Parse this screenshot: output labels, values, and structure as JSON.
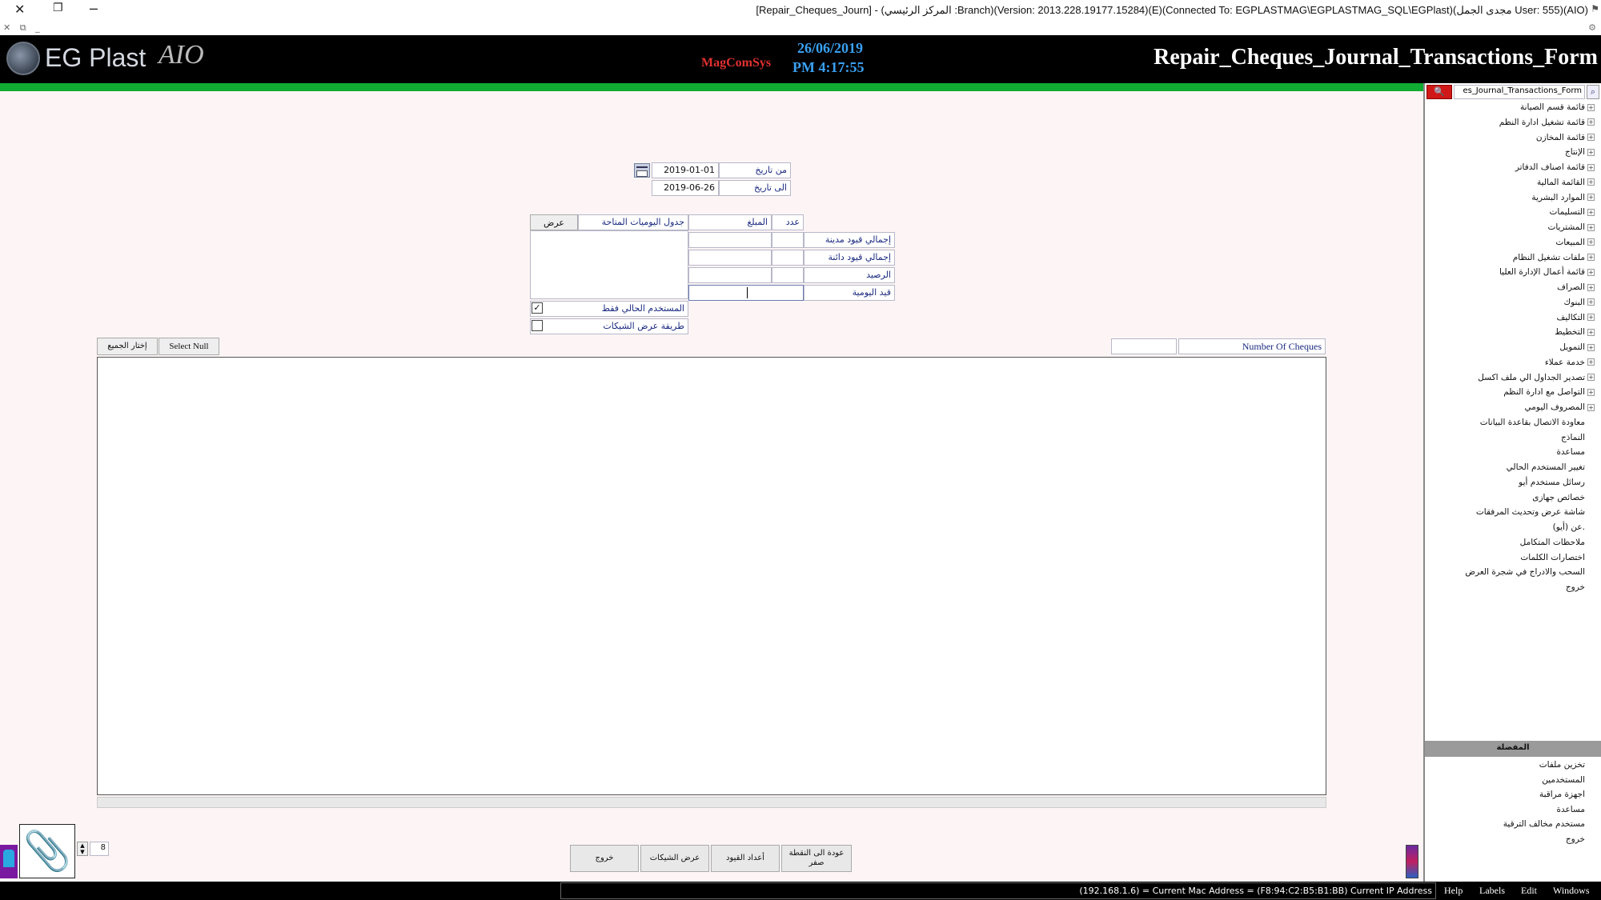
{
  "window": {
    "title": "[Repair_Cheques_Journ] - (المركز الرئيسي :Branch)(Version: 2013.228.19177.15284)(E)(Connected To: EGPLASTMAG\\EGPLASTMAG_SQL\\EGPlast)(مجدى الجمل User: 555)(AIO)"
  },
  "header": {
    "logo_text": "EG Plast",
    "logo_suffix": "AIO",
    "brand": "MagComSys",
    "date": "26/06/2019",
    "time": "PM 4:17:55",
    "form_title": "Repair_Cheques_Journal_Transactions_Form"
  },
  "filters": {
    "from_date_label": "من تاريخ",
    "from_date_value": "2019-01-01",
    "to_date_label": "الى تاريخ",
    "to_date_value": "2019-06-26"
  },
  "summary": {
    "count_header": "عدد",
    "amount_header": "المبلغ",
    "available_journals_label": "جدول اليوميات المتاحة",
    "show_button": "عرض",
    "total_debit_label": "إجمالي قيود مدينة",
    "total_credit_label": "إجمالي قيود دائنة",
    "balance_label": "الرصيد",
    "journal_entry_label": "قيد اليومية",
    "current_user_only_label": "المستخدم الحالي فقط",
    "current_user_only_checked": true,
    "cheque_display_method_label": "طريقة عرض الشيكات",
    "cheque_display_method_checked": false
  },
  "grid_toolbar": {
    "select_all": "إختار الجميع",
    "select_null": "Select Null",
    "number_of_cheques_label": "Number Of Cheques",
    "number_of_cheques_value": ""
  },
  "footer": {
    "stepper_value": "8",
    "exit_button": "خروج",
    "show_cheques_button": "عرض الشيكات",
    "repeat_entries_button": "أعداد القيود",
    "back_to_zero_line1": "عودة الى النقطة",
    "back_to_zero_line2": "صفر"
  },
  "right_panel": {
    "search_value": "es_Journal_Transactions_Form",
    "tree_items": [
      "قائمة قسم الصيانة",
      "قائمة تشغيل ادارة النظم",
      "قائمة المخازن",
      "الإنتاج",
      "قائمة اصناف الدفاتر",
      "القائمة المالية",
      "الموارد البشرية",
      "التسليمات",
      "المشتريات",
      "المبيعات",
      "ملفات تشغيل النظام",
      "قائمة أعمال الإدارة العليا",
      "الصراف",
      "البنوك",
      "التكاليف",
      "التخطيط",
      "التمويل",
      "خدمة عملاء",
      "تصدير الجداول الي ملف اكسل",
      "التواصل مع ادارة النظم",
      "المصروف اليومي",
      "معاودة الاتصال بقاعدة البيانات",
      "النماذج",
      "مساعدة",
      "تغيير المستخدم الحالي",
      "رسائل مستخدم أيو",
      "خصائص جهازى",
      "شاشة عرض وتحديث المرفقات",
      "عن (أيو).",
      "ملاحظات المتكامل",
      "اختصارات الكلمات",
      "السحب والادراج في شجرة العرض",
      "خروج"
    ],
    "favorites_header": "المفضلة",
    "favorites": [
      "تخزين ملفات",
      "المستخدمين",
      "اجهزة مراقبة",
      "مساعدة",
      "مستخدم مخالف الترقية",
      "خروج"
    ]
  },
  "status_bar": {
    "info": "(192.168.1.6) = Current Mac Address = (F8:94:C2:B5:B1:BB) Current IP Address",
    "menus": [
      "Help",
      "Labels",
      "Edit",
      "Windows"
    ]
  }
}
